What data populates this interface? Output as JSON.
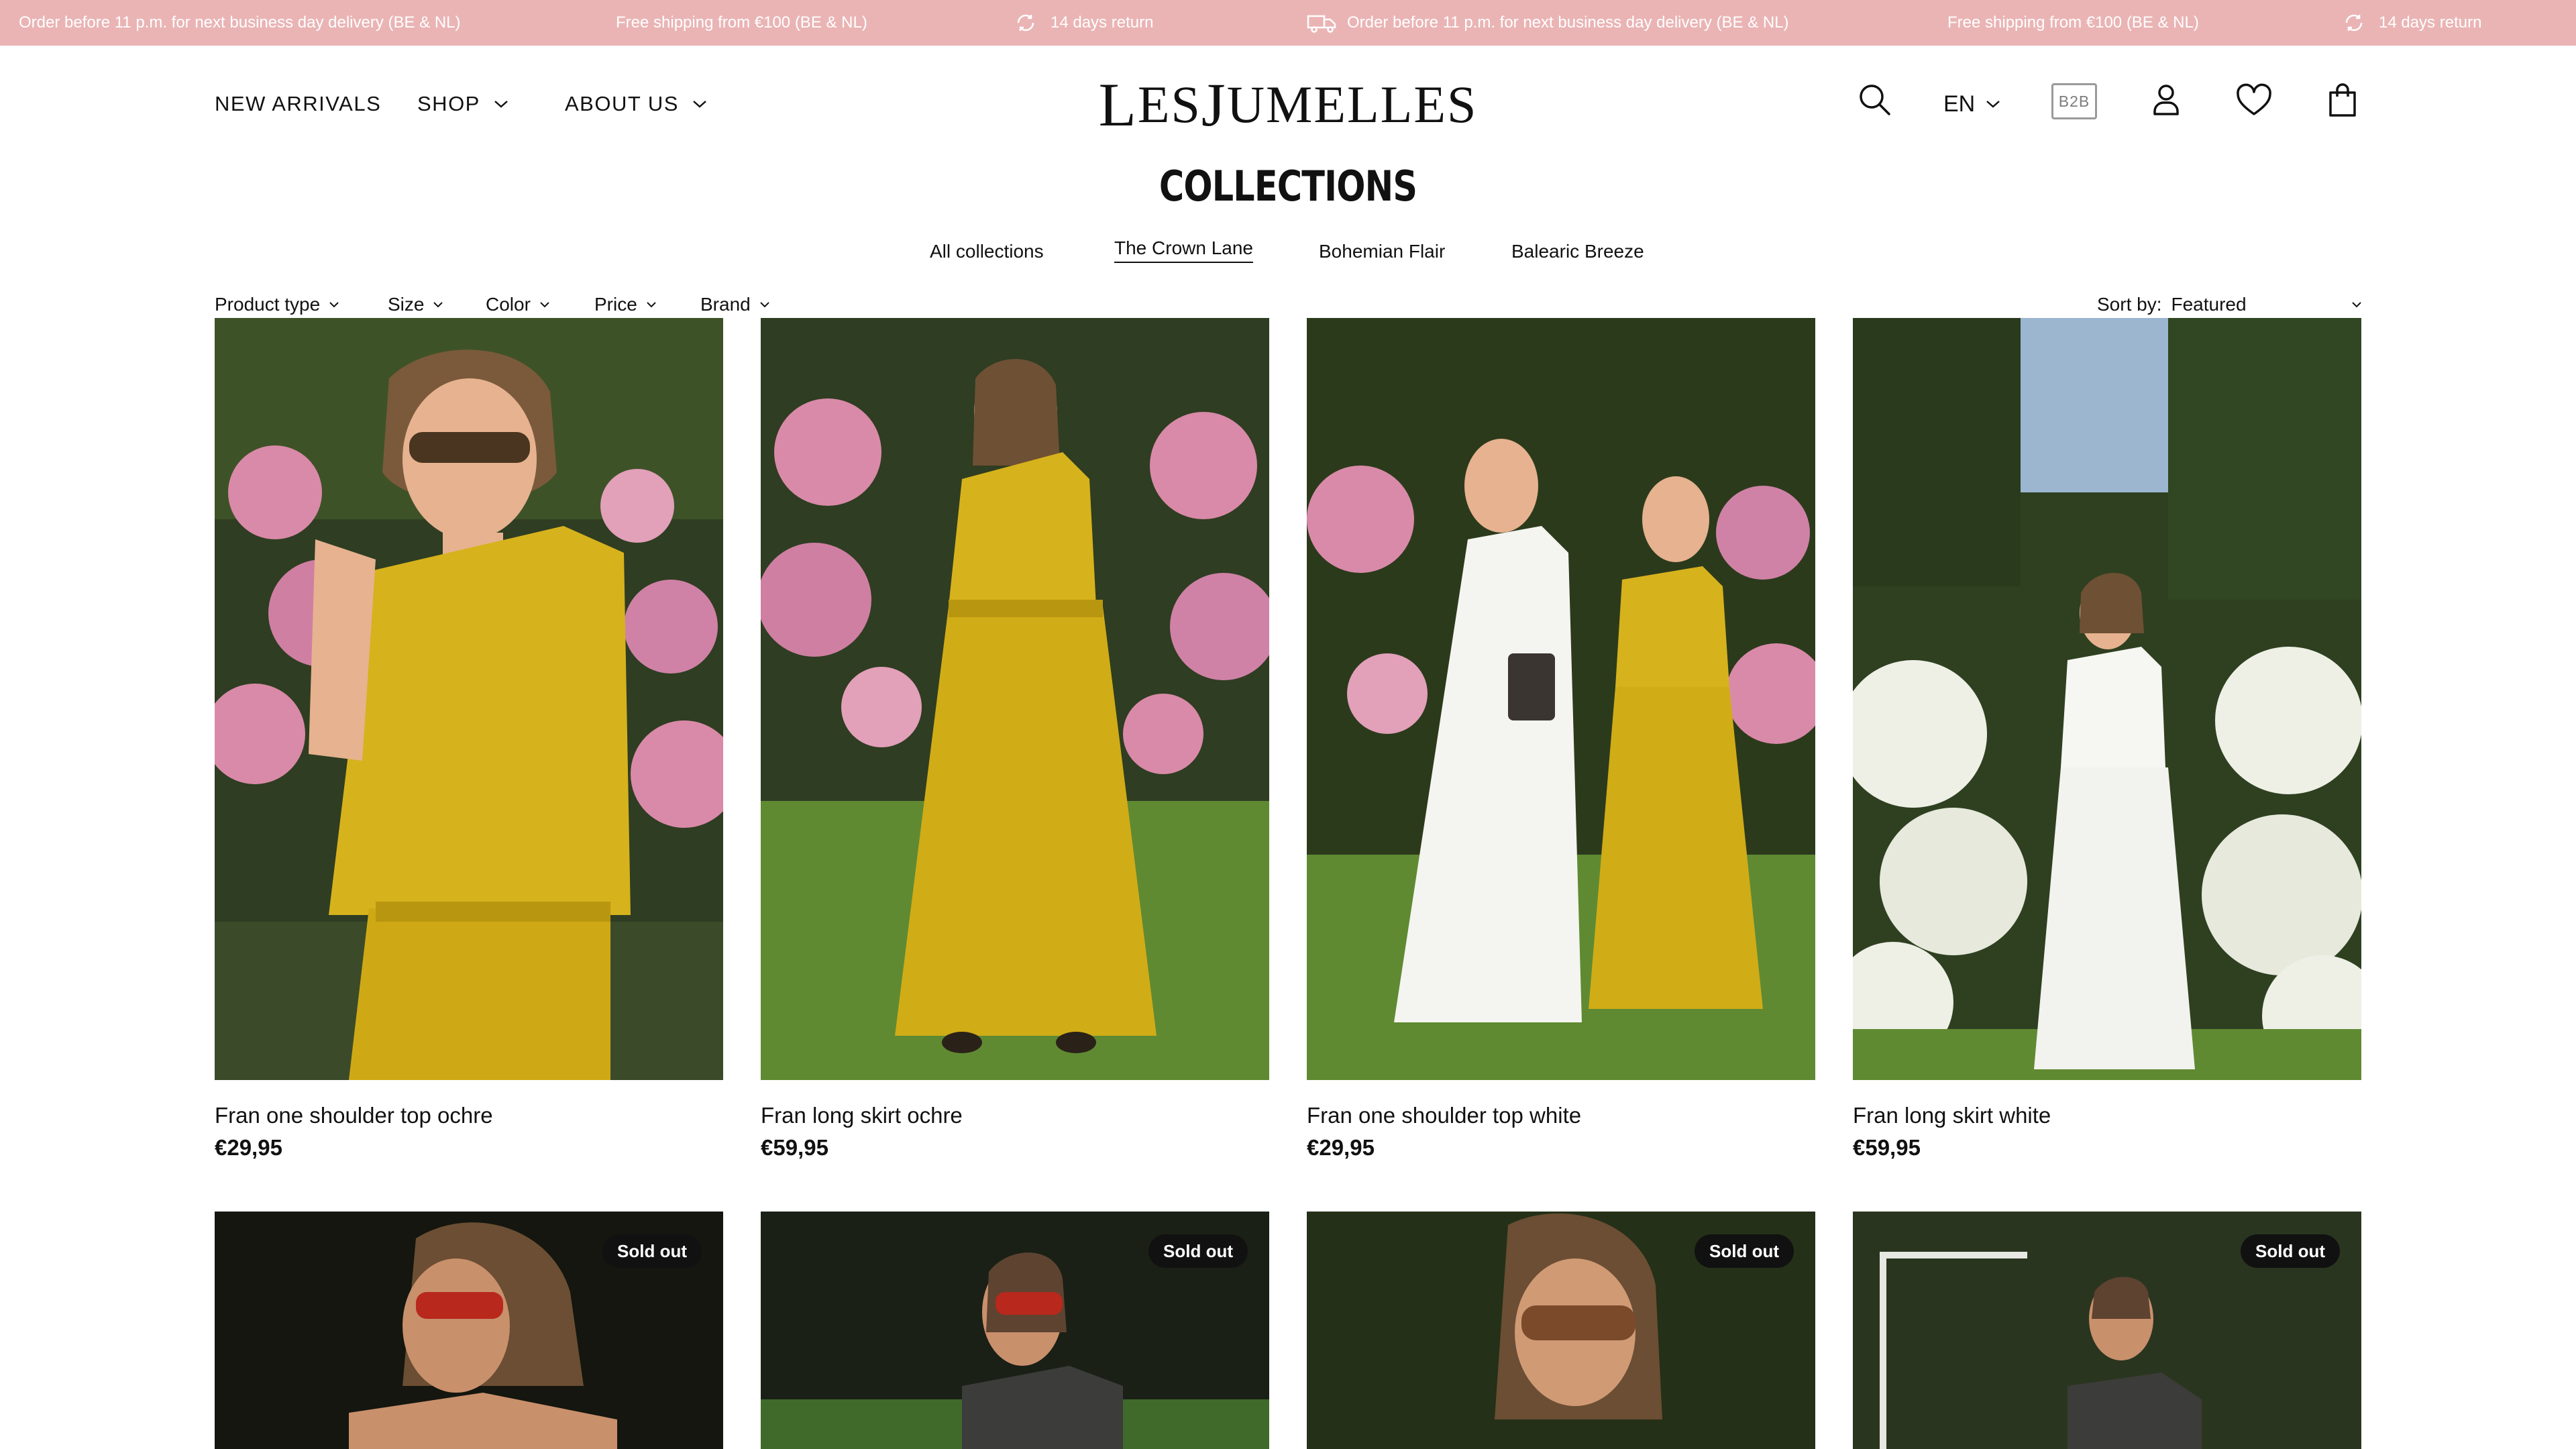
{
  "announcement": {
    "delivery": "Order before 11 p.m. for next business day delivery (BE & NL)",
    "shipping": "Free shipping from €100 (BE & NL)",
    "returns": "14 days return"
  },
  "header": {
    "nav": {
      "new_arrivals": "NEW ARRIVALS",
      "shop": "SHOP",
      "about_us": "ABOUT US"
    },
    "logo": {
      "first_l": "L",
      "rest_1": "ES ",
      "first_j": "J",
      "rest_2": "UMELLES"
    },
    "language": "EN",
    "b2b": "B2B"
  },
  "page": {
    "title": "COLLECTIONS",
    "tabs": [
      "All collections",
      "The Crown Lane",
      "Bohemian Flair",
      "Balearic Breeze"
    ],
    "active_tab": "The Crown Lane"
  },
  "filters": {
    "items": [
      "Product type",
      "Size",
      "Color",
      "Price",
      "Brand"
    ],
    "sort_label": "Sort by:",
    "sort_value": "Featured"
  },
  "products": [
    {
      "name": "Fran one shoulder top ochre",
      "price": "€29,95"
    },
    {
      "name": "Fran long skirt ochre",
      "price": "€59,95"
    },
    {
      "name": "Fran one shoulder top white",
      "price": "€29,95"
    },
    {
      "name": "Fran long skirt white",
      "price": "€59,95"
    }
  ],
  "row2": {
    "badge": "Sold out"
  },
  "colors": {
    "announcement_bg": "#eab4b5",
    "ochre": "#d6b21c",
    "foliage": "#2c3a1c",
    "hydrangea_pink": "#d98aa8",
    "hydrangea_white": "#eef0e6"
  }
}
